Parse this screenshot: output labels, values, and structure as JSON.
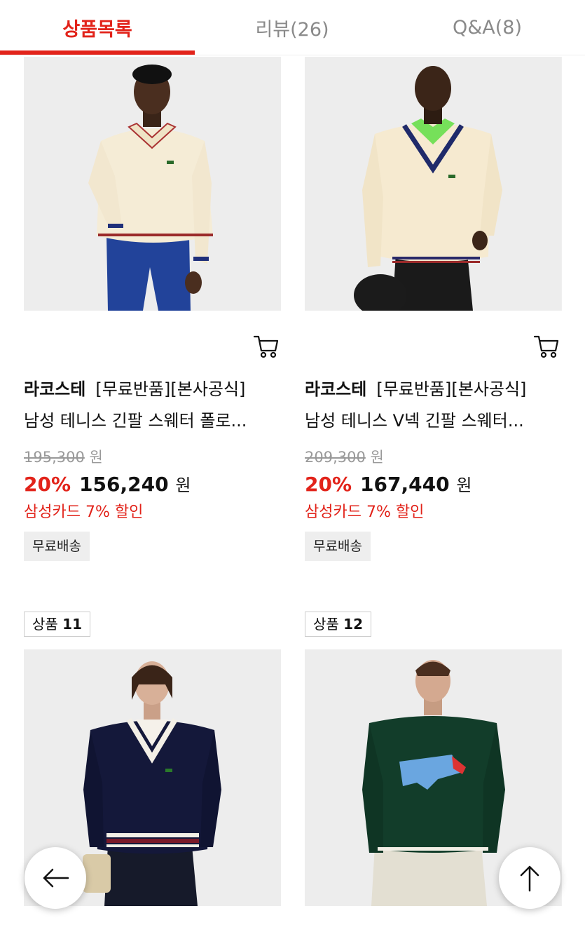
{
  "tabs": [
    {
      "label": "상품목록",
      "active": true
    },
    {
      "label": "리뷰(26)",
      "active": false
    },
    {
      "label": "Q&A(8)",
      "active": false
    }
  ],
  "products": [
    {
      "brand": "라코스테",
      "title_line1": "[무료반품][본사공식]",
      "title_line2": "남성 테니스 긴팔 스웨터 폴로...",
      "original_price": "195,300",
      "discount": "20%",
      "price": "156,240",
      "currency": "원",
      "card_promo": "삼성카드 7% 할인",
      "shipping": "무료배송",
      "image_desc": "cream cable-knit polo sweater with striped trim, blue jeans"
    },
    {
      "brand": "라코스테",
      "title_line1": "[무료반품][본사공식]",
      "title_line2": "남성 테니스 V넥 긴팔 스웨터...",
      "original_price": "209,300",
      "discount": "20%",
      "price": "167,440",
      "currency": "원",
      "card_promo": "삼성카드 7% 할인",
      "shipping": "무료배송",
      "image_desc": "cream V-neck tennis sweater over green polo"
    },
    {
      "badge_label": "상품",
      "badge_num": "11",
      "image_desc": "navy V-neck cable sweater with striped hem"
    },
    {
      "badge_label": "상품",
      "badge_num": "12",
      "image_desc": "dark green crewneck sweater with blue crocodile"
    }
  ],
  "icons": {
    "cart": "cart-icon",
    "back": "arrow-left-icon",
    "top": "arrow-up-icon"
  },
  "colors": {
    "accent": "#e2231a",
    "muted": "#999999"
  }
}
